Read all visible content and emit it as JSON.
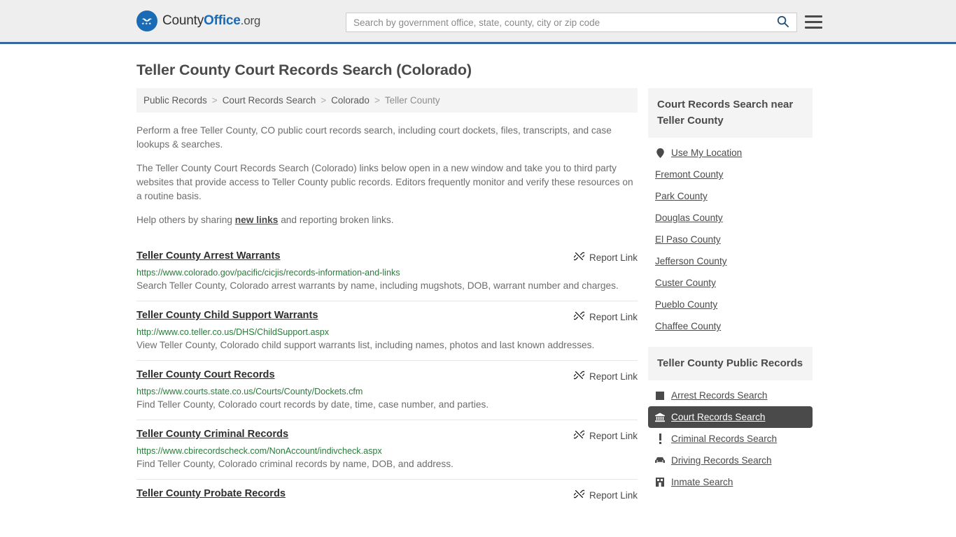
{
  "header": {
    "logo": {
      "part1": "County",
      "part2": "Office",
      "part3": ".org",
      "icon": "eagle-seal-icon"
    },
    "search": {
      "placeholder": "Search by government office, state, county, city or zip code",
      "value": ""
    },
    "search_icon": "search-icon",
    "menu_icon": "hamburger-menu-icon"
  },
  "page": {
    "title": "Teller County Court Records Search (Colorado)"
  },
  "breadcrumb": {
    "items": [
      {
        "label": "Public Records",
        "current": false
      },
      {
        "label": "Court Records Search",
        "current": false
      },
      {
        "label": "Colorado",
        "current": false
      },
      {
        "label": "Teller County",
        "current": true
      }
    ],
    "separator": ">"
  },
  "intro": {
    "p1": "Perform a free Teller County, CO public court records search, including court dockets, files, transcripts, and case lookups & searches.",
    "p2": "The Teller County Court Records Search (Colorado) links below open in a new window and take you to third party websites that provide access to Teller County public records. Editors frequently monitor and verify these resources on a routine basis.",
    "p3_before": "Help others by sharing ",
    "p3_link": "new links",
    "p3_after": " and reporting broken links."
  },
  "results": {
    "report_label": "Report Link",
    "report_icon": "broken-link-icon",
    "items": [
      {
        "title": "Teller County Arrest Warrants",
        "url": "https://www.colorado.gov/pacific/cicjis/records-information-and-links",
        "desc": "Search Teller County, Colorado arrest warrants by name, including mugshots, DOB, warrant number and charges."
      },
      {
        "title": "Teller County Child Support Warrants",
        "url": "http://www.co.teller.co.us/DHS/ChildSupport.aspx",
        "desc": "View Teller County, Colorado child support warrants list, including names, photos and last known addresses."
      },
      {
        "title": "Teller County Court Records",
        "url": "https://www.courts.state.co.us/Courts/County/Dockets.cfm",
        "desc": "Find Teller County, Colorado court records by date, time, case number, and parties."
      },
      {
        "title": "Teller County Criminal Records",
        "url": "https://www.cbirecordscheck.com/NonAccount/indivcheck.aspx",
        "desc": "Find Teller County, Colorado criminal records by name, DOB, and address."
      },
      {
        "title": "Teller County Probate Records",
        "url": "",
        "desc": ""
      }
    ]
  },
  "sidebar": {
    "nearby": {
      "heading": "Court Records Search near Teller County",
      "items": [
        {
          "label": "Use My Location",
          "icon": "map-pin-icon",
          "active": false
        },
        {
          "label": "Fremont County",
          "icon": "",
          "active": false
        },
        {
          "label": "Park County",
          "icon": "",
          "active": false
        },
        {
          "label": "Douglas County",
          "icon": "",
          "active": false
        },
        {
          "label": "El Paso County",
          "icon": "",
          "active": false
        },
        {
          "label": "Jefferson County",
          "icon": "",
          "active": false
        },
        {
          "label": "Custer County",
          "icon": "",
          "active": false
        },
        {
          "label": "Pueblo County",
          "icon": "",
          "active": false
        },
        {
          "label": "Chaffee County",
          "icon": "",
          "active": false
        }
      ]
    },
    "public_records": {
      "heading": "Teller County Public Records",
      "items": [
        {
          "label": "Arrest Records Search",
          "icon": "square-badge-icon",
          "active": false
        },
        {
          "label": "Court Records Search",
          "icon": "courthouse-icon",
          "active": true
        },
        {
          "label": "Criminal Records Search",
          "icon": "exclamation-icon",
          "active": false
        },
        {
          "label": "Driving Records Search",
          "icon": "car-icon",
          "active": false
        },
        {
          "label": "Inmate Search",
          "icon": "building-icon",
          "active": false
        }
      ]
    }
  },
  "colors": {
    "header_bg": "#eeeeee",
    "header_border": "#33699e",
    "brand_blue": "#1a6bb5",
    "url_green": "#2a7a3b",
    "active_bg": "#4a4a4a",
    "panel_bg": "#f4f4f4"
  }
}
